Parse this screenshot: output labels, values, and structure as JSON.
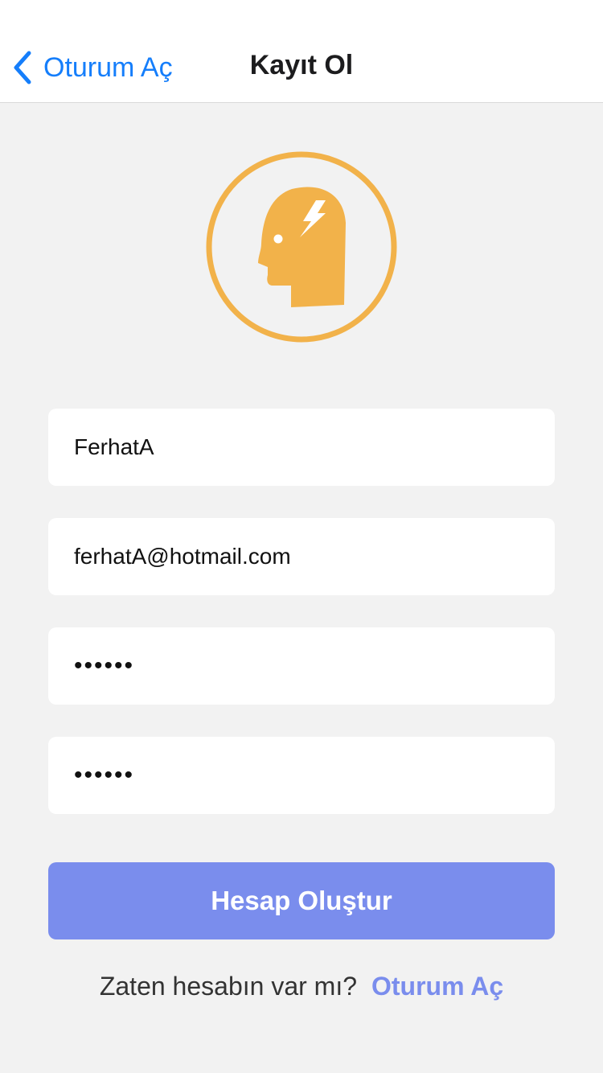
{
  "navbar": {
    "back_label": "Oturum Aç",
    "title": "Kayıt Ol"
  },
  "logo": {
    "icon": "head-lightning-icon",
    "color": "#f2b24a"
  },
  "form": {
    "username_value": "FerhatA",
    "email_value": "ferhatA@hotmail.com",
    "password_value": "••••••",
    "confirm_password_value": "••••••"
  },
  "actions": {
    "create_account_label": "Hesap Oluştur"
  },
  "footer": {
    "prompt": "Zaten hesabın var mı?",
    "login_link": "Oturum Aç"
  },
  "colors": {
    "nav_accent": "#157efb",
    "button": "#7a8ded",
    "background": "#f2f2f2"
  }
}
